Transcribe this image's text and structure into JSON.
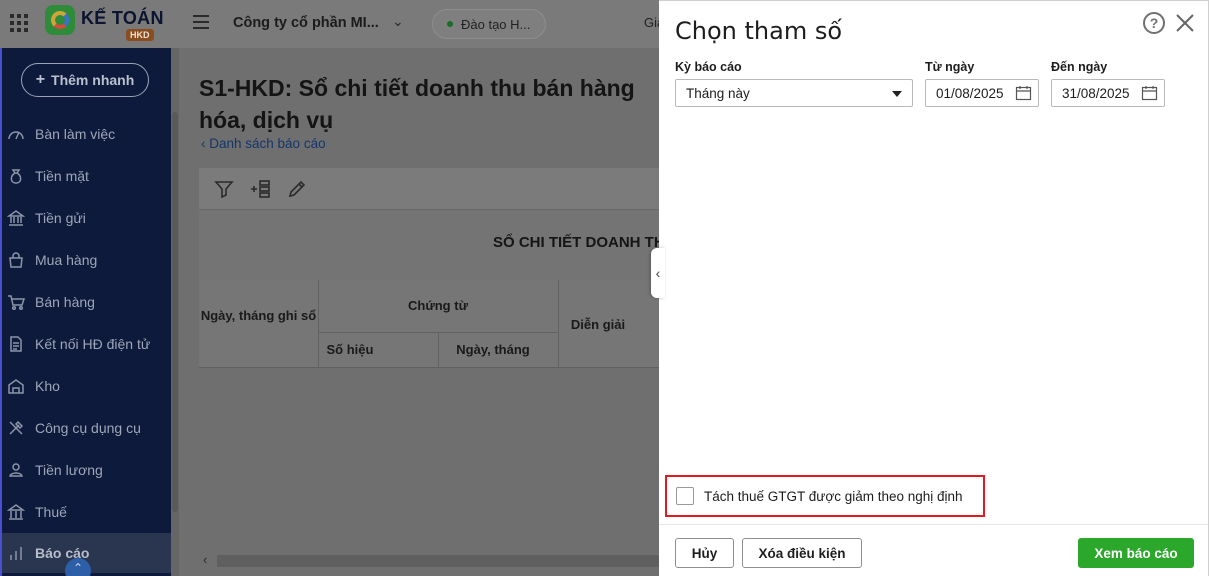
{
  "app": {
    "logo_text": "KẾ TOÁN",
    "logo_badge": "HKD",
    "company": "Công ty cổ phần MI...",
    "environment": "Đào tạo H...",
    "top_cut_text": "Gia"
  },
  "sidebar": {
    "quick_add_label": "Thêm nhanh",
    "items": [
      {
        "label": "Bàn làm việc",
        "icon": "dashboard-icon"
      },
      {
        "label": "Tiền mặt",
        "icon": "money-bag-icon"
      },
      {
        "label": "Tiền gửi",
        "icon": "bank-icon"
      },
      {
        "label": "Mua hàng",
        "icon": "shopping-bag-icon"
      },
      {
        "label": "Bán hàng",
        "icon": "cart-icon"
      },
      {
        "label": "Kết nối HĐ điện tử",
        "icon": "invoice-icon"
      },
      {
        "label": "Kho",
        "icon": "warehouse-icon"
      },
      {
        "label": "Công cụ dụng cụ",
        "icon": "tools-icon"
      },
      {
        "label": "Tiền lương",
        "icon": "salary-icon"
      },
      {
        "label": "Thuế",
        "icon": "tax-icon"
      },
      {
        "label": "Báo cáo",
        "icon": "report-chart-icon"
      }
    ]
  },
  "report": {
    "title": "S1-HKD: Sổ chi tiết doanh thu bán hàng hóa, dịch vụ",
    "back_link": "Danh sách báo cáo",
    "heading": "SỔ CHI TIẾT DOANH THU",
    "columns": {
      "date_record": "Ngày, tháng ghi sổ",
      "voucher": "Chứng từ",
      "voucher_no": "Số hiệu",
      "voucher_date": "Ngày, tháng",
      "description": "Diễn giải"
    }
  },
  "panel": {
    "title": "Chọn tham số",
    "period_label": "Kỳ báo cáo",
    "period_value": "Tháng này",
    "from_label": "Từ ngày",
    "from_value": "01/08/2025",
    "to_label": "Đến ngày",
    "to_value": "31/08/2025",
    "checkbox_label": "Tách thuế GTGT được giảm theo nghị định",
    "checkbox_checked": false,
    "cancel_label": "Hủy",
    "clear_label": "Xóa điều kiện",
    "view_label": "Xem báo cáo"
  },
  "colors": {
    "primary_button": "#2ba82c",
    "highlight_border": "#e11b22",
    "sidebar_bg": "#0e1a3b"
  }
}
